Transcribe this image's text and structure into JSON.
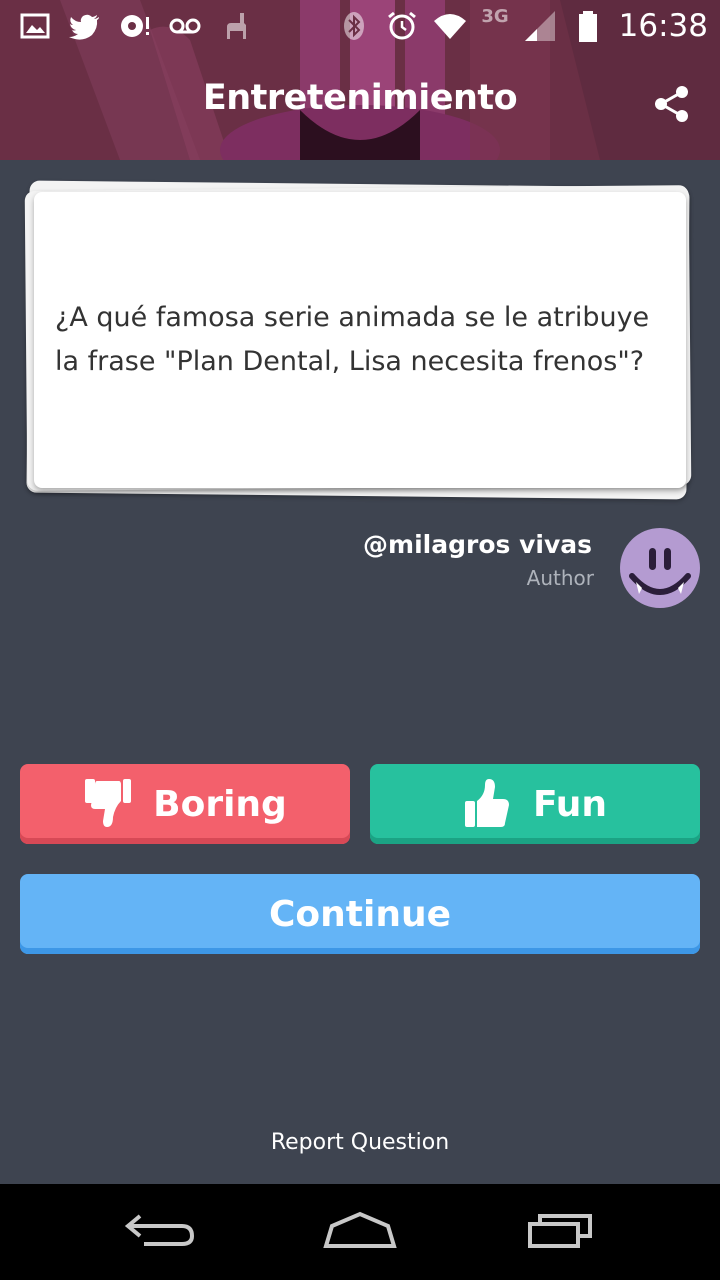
{
  "status_bar": {
    "network": "3G",
    "time": "16:38",
    "left_icons": [
      "image-icon",
      "twitter-icon",
      "sync-alert-icon",
      "voicemail-icon",
      "llama-icon"
    ],
    "right_icons": [
      "bluetooth-icon",
      "alarm-icon",
      "wifi-icon",
      "signal-icon",
      "battery-icon"
    ]
  },
  "header": {
    "title": "Entretenimiento",
    "share_icon": "share-icon",
    "background_color": "#6a2f45"
  },
  "question": {
    "text": "¿A qué famosa serie animada se le atribuye la frase \"Plan Dental, Lisa necesita frenos\"?"
  },
  "author": {
    "name": "@milagros vivas",
    "role": "Author",
    "avatar_icon": "smiley-avatar-icon"
  },
  "actions": {
    "boring_label": "Boring",
    "fun_label": "Fun",
    "continue_label": "Continue",
    "boring_color": "#f3606c",
    "fun_color": "#27c19e",
    "continue_color": "#64b4f6"
  },
  "footer": {
    "report_label": "Report Question"
  },
  "navigation": {
    "icons": [
      "back-icon",
      "home-icon",
      "recents-icon"
    ]
  }
}
